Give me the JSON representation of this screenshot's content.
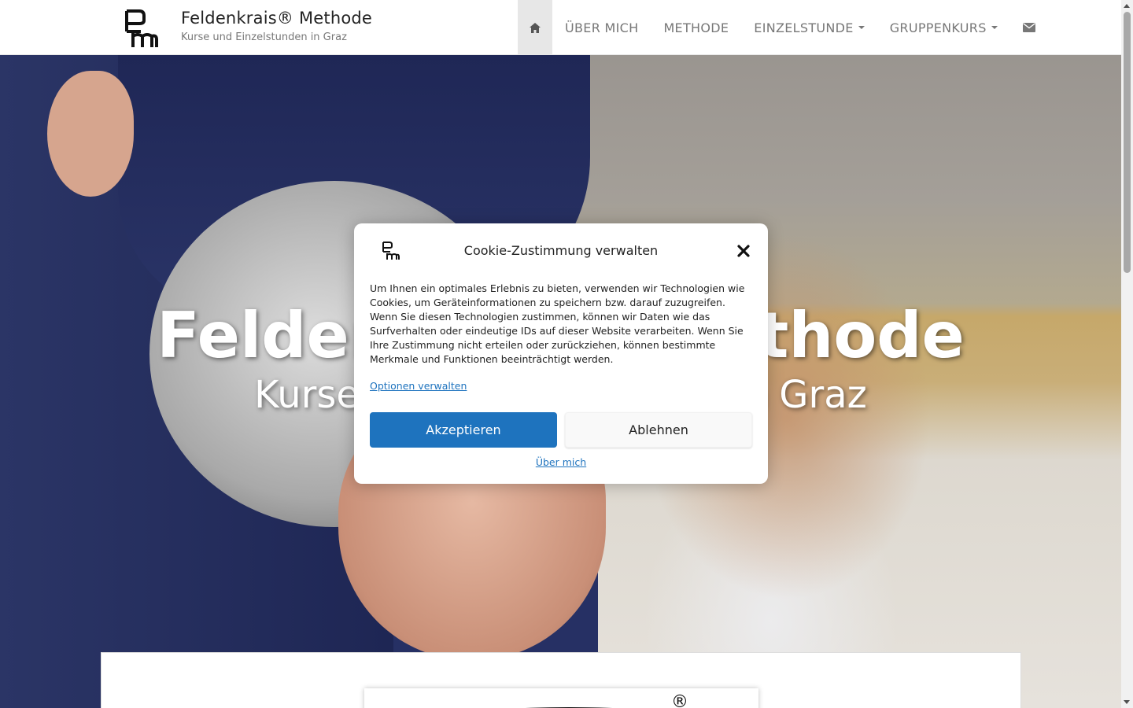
{
  "header": {
    "site_title": "Feldenkrais® Methode",
    "site_subtitle": "Kurse und Einzelstunden in Graz",
    "logo_icon": "fm-logo-icon"
  },
  "nav": {
    "home_icon": "home-icon",
    "items": [
      {
        "label": "ÜBER MICH"
      },
      {
        "label": "METHODE"
      },
      {
        "label": "EINZELSTUNDE",
        "dropdown": true
      },
      {
        "label": "GRUPPENKURS",
        "dropdown": true
      }
    ],
    "contact_icon": "envelope-icon",
    "active_color": "#e7e7e7",
    "text_color": "#777777"
  },
  "hero": {
    "title": "Feldenkrais® Methode",
    "subtitle": "Kurse und Einzelstunden in Graz"
  },
  "cookie_modal": {
    "title": "Cookie-Zustimmung verwalten",
    "text": "Um Ihnen ein optimales Erlebnis zu bieten, verwenden wir Technologien wie Cookies, um Geräteinformationen zu speichern bzw. darauf zuzugreifen. Wenn Sie diesen Technologien zustimmen, können wir Daten wie das Surfverhalten oder eindeutige IDs auf dieser Website verarbeiten. Wenn Sie Ihre Zustimmung nicht erteilen oder zurückziehen, können bestimmte Merkmale und Funktionen beeinträchtigt werden.",
    "options_link": "Optionen verwalten",
    "accept_label": "Akzeptieren",
    "deny_label": "Ablehnen",
    "footer_link": "Über mich",
    "accent_color": "#1e73be"
  },
  "content": {
    "registered_mark": "®"
  }
}
